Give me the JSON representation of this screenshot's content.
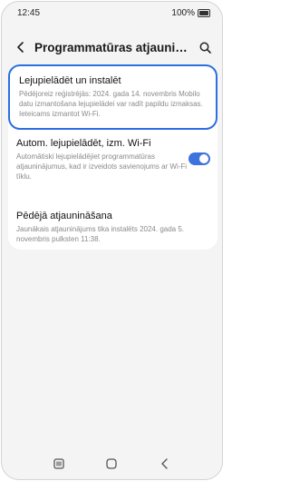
{
  "status_bar": {
    "time": "12:45",
    "battery": "100%"
  },
  "header": {
    "title": "Programmatūras atjauninā..."
  },
  "items": {
    "download": {
      "title": "Lejupielādēt un instalēt",
      "subtitle": "Pēdējoreiz reģistrējās: 2024. gada 14. novembris Mobilo datu izmantošana lejupielādei var radīt papildu izmaksas. Ieteicams izmantot Wi-Fi."
    },
    "auto_download": {
      "title": "Autom. lejupielādēt, izm. Wi-Fi",
      "subtitle": "Automātiski lejupielādējiet programmatūras atjauninājumus, kad ir izveidots savienojums ar Wi-Fi tīklu.",
      "enabled": true
    },
    "last_update": {
      "title": "Pēdējā atjaunināšana",
      "subtitle": "Jaunākais atjauninājums tika instalēts 2024. gada 5. novembris pulksten 11:38."
    }
  },
  "colors": {
    "accent": "#3e73dd",
    "focus_border": "#2c6fe0",
    "background": "#f4f4f4"
  }
}
